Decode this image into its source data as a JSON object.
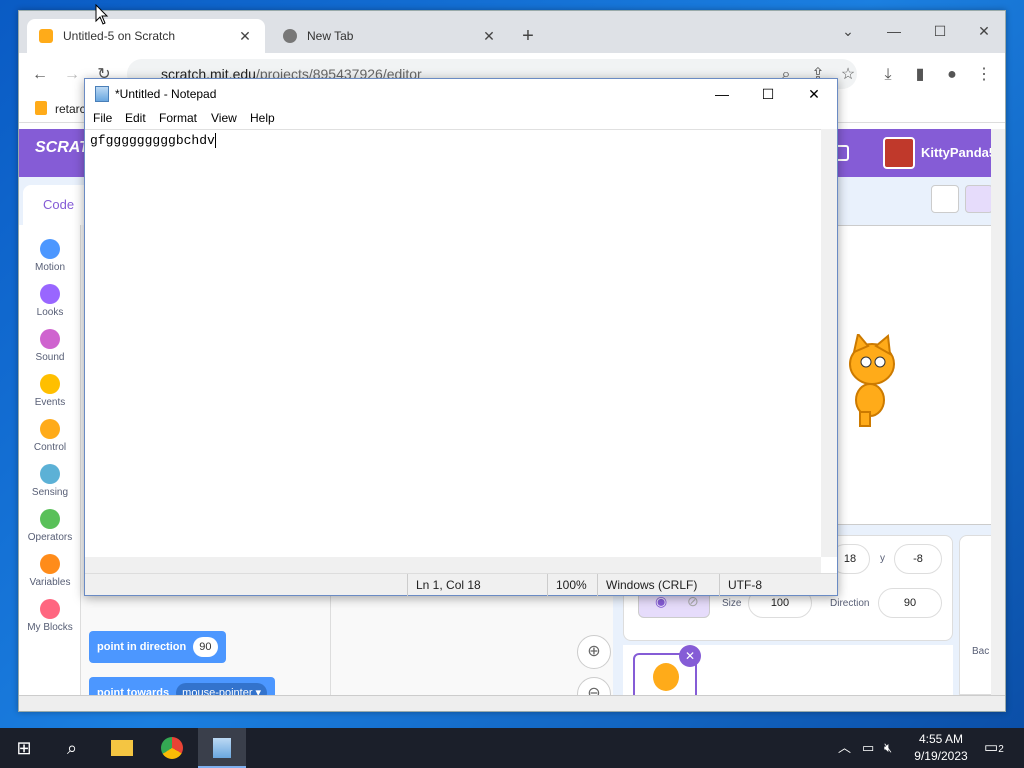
{
  "browser": {
    "tabs": [
      {
        "title": "Untitled-5 on Scratch",
        "active": true
      },
      {
        "title": "New Tab",
        "active": false
      }
    ],
    "new_tab_symbol": "+",
    "url_host": "scratch.mit.edu",
    "url_path": "/projects/895437926/editor",
    "bookmark": "retarc"
  },
  "scratch": {
    "logo": "SCRATCH",
    "username": "KittyPanda5",
    "code_tab": "Code",
    "categories": [
      {
        "label": "Motion",
        "color": "#4c97ff"
      },
      {
        "label": "Looks",
        "color": "#9966ff"
      },
      {
        "label": "Sound",
        "color": "#cf63cf"
      },
      {
        "label": "Events",
        "color": "#ffbf00"
      },
      {
        "label": "Control",
        "color": "#ffab19"
      },
      {
        "label": "Sensing",
        "color": "#5cb1d6"
      },
      {
        "label": "Operators",
        "color": "#59c059"
      },
      {
        "label": "Variables",
        "color": "#ff8c1a"
      },
      {
        "label": "My Blocks",
        "color": "#ff6680"
      }
    ],
    "blocks": {
      "point_direction": "point in direction",
      "point_direction_value": "90",
      "point_towards": "point towards",
      "point_towards_value": "mouse-pointer"
    },
    "sprite": {
      "x": "18",
      "y_label": "y",
      "y": "-8",
      "size_label": "Size",
      "size": "100",
      "direction_label": "Direction",
      "direction": "90",
      "backdrops_label": "Bac"
    }
  },
  "notepad": {
    "title": "*Untitled - Notepad",
    "menu": [
      "File",
      "Edit",
      "Format",
      "View",
      "Help"
    ],
    "content": "gfgggggggggbchdv",
    "status": {
      "position": "Ln 1, Col 18",
      "zoom": "100%",
      "line_endings": "Windows (CRLF)",
      "encoding": "UTF-8"
    }
  },
  "taskbar": {
    "time": "4:55 AM",
    "date": "9/19/2023",
    "notification_count": "2"
  },
  "icons": {
    "chrome_tab": "chrome-icon",
    "scratch_tab": "scratch-favicon"
  }
}
